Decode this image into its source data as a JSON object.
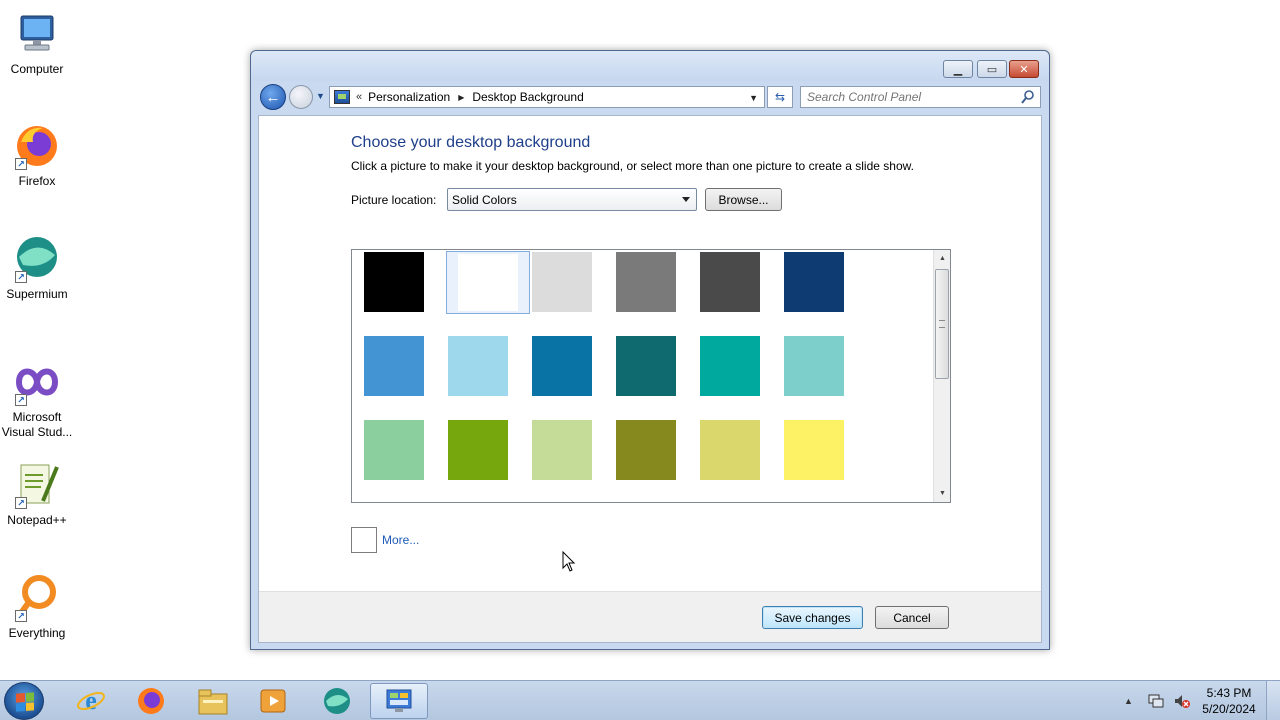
{
  "desktop": {
    "icons": [
      {
        "label": "Computer",
        "icon": "computer-icon"
      },
      {
        "label": "Firefox",
        "icon": "firefox-icon"
      },
      {
        "label": "Supermium",
        "icon": "supermium-icon"
      },
      {
        "label": "Microsoft Visual Stud...",
        "icon": "visual-studio-icon"
      },
      {
        "label": "Notepad++",
        "icon": "notepadpp-icon"
      },
      {
        "label": "Everything",
        "icon": "everything-icon"
      }
    ]
  },
  "window": {
    "breadcrumb": {
      "items": [
        "Personalization",
        "Desktop Background"
      ],
      "overflow": "«"
    },
    "search": {
      "placeholder": "Search Control Panel"
    },
    "heading": "Choose your desktop background",
    "subtext": "Click a picture to make it your desktop background, or select more than one picture to create a slide show.",
    "picture_location": {
      "label": "Picture location:",
      "value": "Solid Colors"
    },
    "browse_label": "Browse...",
    "swatches": [
      {
        "color": "#000000"
      },
      {
        "color": "#ffffff",
        "selected": true
      },
      {
        "color": "#dcdcdc"
      },
      {
        "color": "#7a7a7a"
      },
      {
        "color": "#4a4a4a"
      },
      {
        "color": "#0f3b73"
      },
      {
        "color": "#4394d2"
      },
      {
        "color": "#9dd8ed"
      },
      {
        "color": "#0a73a6"
      },
      {
        "color": "#0f6a6f"
      },
      {
        "color": "#00a99d"
      },
      {
        "color": "#7ccfcb"
      },
      {
        "color": "#8ccf9e"
      },
      {
        "color": "#76a80e"
      },
      {
        "color": "#c4dc98"
      },
      {
        "color": "#86891e"
      },
      {
        "color": "#dad86c"
      },
      {
        "color": "#fdf266"
      }
    ],
    "more_label": "More...",
    "save_label": "Save changes",
    "cancel_label": "Cancel"
  },
  "taskbar": {
    "items": [
      "internet-explorer-icon",
      "firefox-icon",
      "file-explorer-icon",
      "media-player-icon",
      "supermium-icon",
      "control-panel-icon"
    ],
    "active_item": "control-panel-icon",
    "clock": {
      "time": "5:43 PM",
      "date": "5/20/2024"
    }
  }
}
